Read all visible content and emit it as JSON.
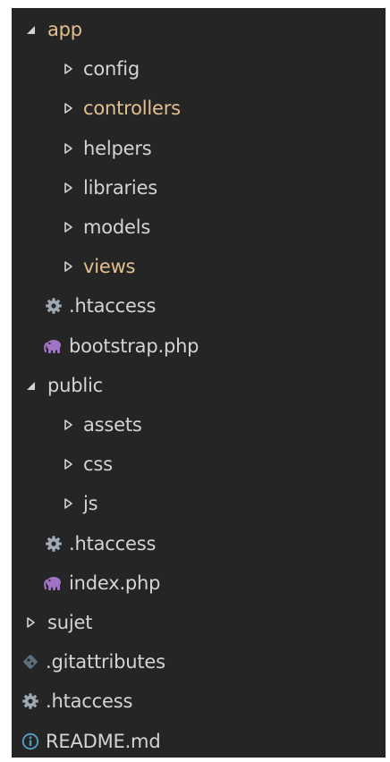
{
  "explorer": {
    "theme": {
      "background": "#252526",
      "text": "#d4d4d4",
      "modified_text": "#e2c08d",
      "gear_icon": "#9fa9b3",
      "php_icon": "#a074c4",
      "git_icon": "#5f6f7a",
      "info_icon": "#519aba"
    },
    "items": [
      {
        "label": "app",
        "kind": "folder-open",
        "depth": 0,
        "modified": true,
        "icon": "chevron-down-icon"
      },
      {
        "label": "config",
        "kind": "folder",
        "depth": 2,
        "modified": false,
        "icon": "chevron-right-icon"
      },
      {
        "label": "controllers",
        "kind": "folder",
        "depth": 2,
        "modified": true,
        "icon": "chevron-right-icon"
      },
      {
        "label": "helpers",
        "kind": "folder",
        "depth": 2,
        "modified": false,
        "icon": "chevron-right-icon"
      },
      {
        "label": "libraries",
        "kind": "folder",
        "depth": 2,
        "modified": false,
        "icon": "chevron-right-icon"
      },
      {
        "label": "models",
        "kind": "folder",
        "depth": 2,
        "modified": false,
        "icon": "chevron-right-icon"
      },
      {
        "label": "views",
        "kind": "folder",
        "depth": 2,
        "modified": true,
        "icon": "chevron-right-icon"
      },
      {
        "label": ".htaccess",
        "kind": "file",
        "depth": 1,
        "modified": false,
        "icon": "gear-icon"
      },
      {
        "label": "bootstrap.php",
        "kind": "file",
        "depth": 1,
        "modified": false,
        "icon": "php-elephant-icon"
      },
      {
        "label": "public",
        "kind": "folder-open",
        "depth": 0,
        "modified": false,
        "icon": "chevron-down-icon"
      },
      {
        "label": "assets",
        "kind": "folder",
        "depth": 2,
        "modified": false,
        "icon": "chevron-right-icon"
      },
      {
        "label": "css",
        "kind": "folder",
        "depth": 2,
        "modified": false,
        "icon": "chevron-right-icon"
      },
      {
        "label": "js",
        "kind": "folder",
        "depth": 2,
        "modified": false,
        "icon": "chevron-right-icon"
      },
      {
        "label": ".htaccess",
        "kind": "file",
        "depth": 1,
        "modified": false,
        "icon": "gear-icon"
      },
      {
        "label": "index.php",
        "kind": "file",
        "depth": 1,
        "modified": false,
        "icon": "php-elephant-icon"
      },
      {
        "label": "sujet",
        "kind": "folder",
        "depth": 0,
        "modified": false,
        "icon": "chevron-right-icon"
      },
      {
        "label": ".gitattributes",
        "kind": "file",
        "depth": 0,
        "modified": false,
        "icon": "git-icon"
      },
      {
        "label": ".htaccess",
        "kind": "file",
        "depth": 0,
        "modified": false,
        "icon": "gear-icon"
      },
      {
        "label": "README.md",
        "kind": "file",
        "depth": 0,
        "modified": false,
        "icon": "info-icon"
      }
    ]
  }
}
